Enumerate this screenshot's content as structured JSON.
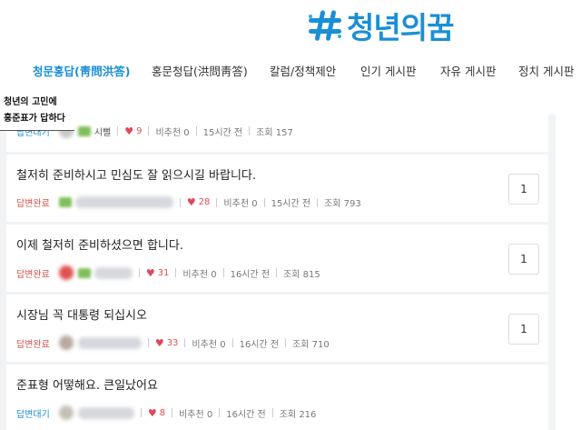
{
  "brand": {
    "name": "청년의꿈",
    "color": "#1a8fd6"
  },
  "nav": {
    "items": [
      {
        "label": "청문홍답(靑問洪答)",
        "active": true
      },
      {
        "label": "홍문청답(洪問靑答)",
        "active": false
      },
      {
        "label": "칼럼/정책제안",
        "active": false
      },
      {
        "label": "인기 게시판",
        "active": false
      },
      {
        "label": "자유 게시판",
        "active": false
      },
      {
        "label": "정치 게시판",
        "active": false
      }
    ]
  },
  "topic_box": {
    "line1": "청년의 고민에",
    "line2": "홍준표가 답하다"
  },
  "posts": [
    {
      "title": "",
      "status": "답변대기",
      "badge": "시뻘",
      "likes": "9",
      "dislikes": "비추천 0",
      "time": "15시간 전",
      "views": "조회 157",
      "replies": ""
    },
    {
      "title": "철저히 준비하시고 민심도 잘 읽으시길 바랍니다.",
      "status": "답변완료",
      "likes": "28",
      "dislikes": "비추천 0",
      "time": "15시간 전",
      "views": "조회 793",
      "replies": "1"
    },
    {
      "title": "이제 철저히 준비하셨으면 합니다.",
      "status": "답변완료",
      "likes": "31",
      "dislikes": "비추천 0",
      "time": "16시간 전",
      "views": "조회 815",
      "replies": "1"
    },
    {
      "title": "시장님 꼭 대통령 되십시오",
      "status": "답변완료",
      "likes": "33",
      "dislikes": "비추천 0",
      "time": "16시간 전",
      "views": "조회 710",
      "replies": "1"
    },
    {
      "title": "준표형 어떻해요. 큰일났어요",
      "status": "답변대기",
      "likes": "8",
      "dislikes": "비추천 0",
      "time": "16시간 전",
      "views": "조회 216",
      "replies": ""
    }
  ]
}
